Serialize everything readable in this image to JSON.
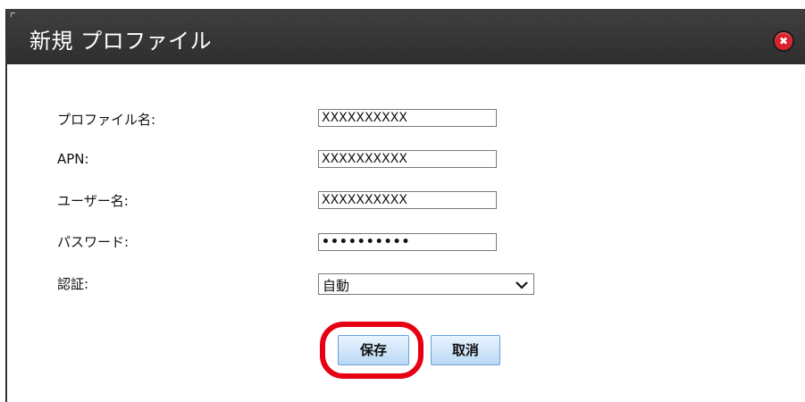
{
  "dialog": {
    "title": "新規 プロファイル",
    "close_icon": "close-icon",
    "close_glyph": "✖"
  },
  "form": {
    "profile_name_label": "プロファイル名:",
    "profile_name_value": "XXXXXXXXXX",
    "apn_label": "APN:",
    "apn_value": "XXXXXXXXXX",
    "username_label": "ユーザー名:",
    "username_value": "XXXXXXXXXX",
    "password_label": "パスワード:",
    "password_value": "••••••••••",
    "auth_label": "認証:",
    "auth_selected": "自動"
  },
  "buttons": {
    "save_label": "保存",
    "cancel_label": "取消"
  },
  "colors": {
    "titlebar": "#333333",
    "close": "#d91f2a",
    "highlight": "#e60012",
    "button_border": "#6aa0d8"
  }
}
